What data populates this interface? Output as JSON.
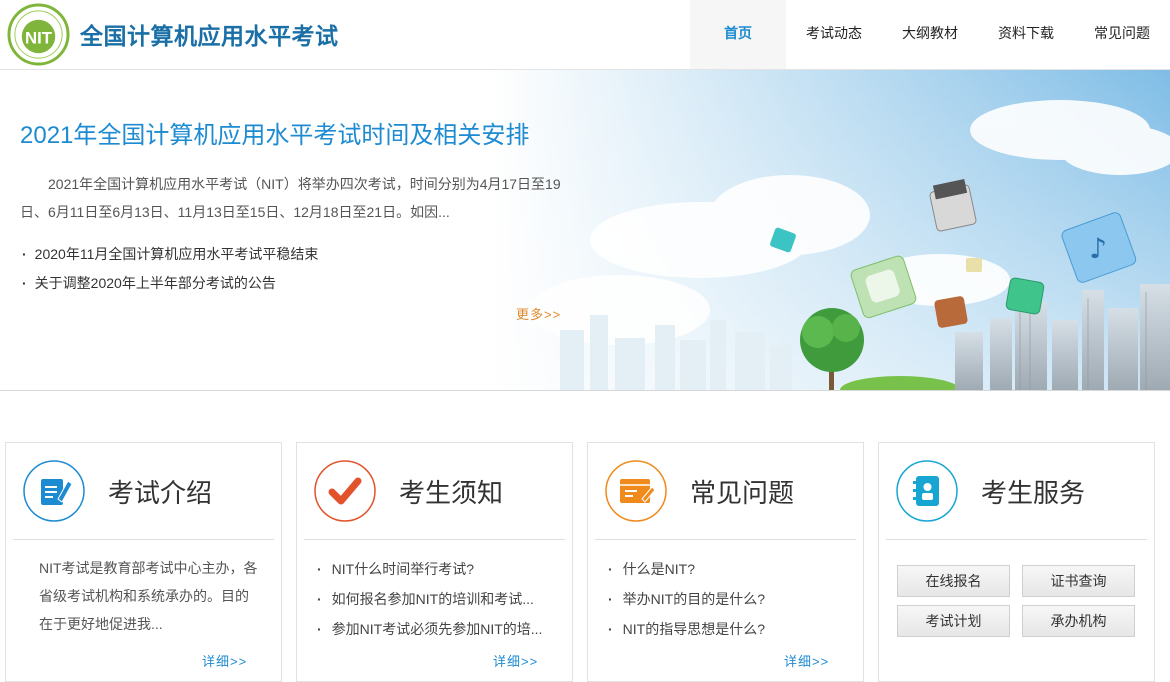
{
  "header": {
    "site_title": "全国计算机应用水平考试",
    "logo_text": "NIT",
    "nav": [
      {
        "label": "首页",
        "active": true
      },
      {
        "label": "考试动态"
      },
      {
        "label": "大纲教材"
      },
      {
        "label": "资料下载"
      },
      {
        "label": "常见问题"
      }
    ]
  },
  "banner": {
    "title": "2021年全国计算机应用水平考试时间及相关安排",
    "description": "2021年全国计算机应用水平考试（NIT）将举办四次考试，时间分别为4月17日至19日、6月11日至6月13日、11月13日至15日、12月18日至21日。如因...",
    "news": [
      "2020年11月全国计算机应用水平考试平稳结束",
      "关于调整2020年上半年部分考试的公告"
    ],
    "more": "更多>>"
  },
  "cards": [
    {
      "title": "考试介绍",
      "icon": "document-edit-icon",
      "color": "#1d8bd1",
      "text": "NIT考试是教育部考试中心主办，各省级考试机构和系统承办的。目的在于更好地促进我...",
      "detail": "详细>>"
    },
    {
      "title": "考生须知",
      "icon": "checkmark-icon",
      "color": "#e2532b",
      "items": [
        "NIT什么时间举行考试?",
        "如何报名参加NIT的培训和考试...",
        "参加NIT考试必须先参加NIT的培..."
      ],
      "detail": "详细>>"
    },
    {
      "title": "常见问题",
      "icon": "browser-edit-icon",
      "color": "#f08a1c",
      "items": [
        "什么是NIT?",
        "举办NIT的目的是什么?",
        "NIT的指导思想是什么?"
      ],
      "detail": "详细>>"
    },
    {
      "title": "考生服务",
      "icon": "contact-book-icon",
      "color": "#17a6d2",
      "buttons": [
        "在线报名",
        "证书查询",
        "考试计划",
        "承办机构"
      ]
    }
  ]
}
